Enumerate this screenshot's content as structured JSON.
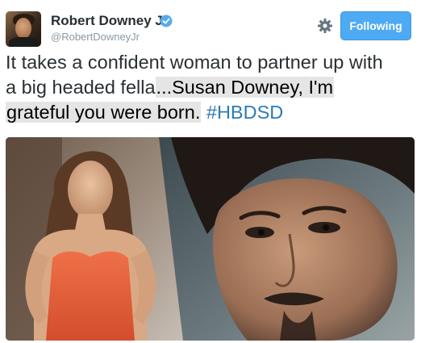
{
  "user": {
    "display_name": "Robert Downey Jr",
    "handle": "@RobertDowneyJr",
    "verified_icon": "verified-badge-icon",
    "avatar_icon": "profile-photo"
  },
  "actions": {
    "settings_icon": "gear-icon",
    "follow_label": "Following",
    "accent_color": "#4eaaf2"
  },
  "tweet": {
    "line1": "It takes a confident woman to partner up with",
    "line2_plain": "a big headed fella",
    "line2_highlight": "...Susan Downey, I'm",
    "line3_highlight": "grateful you were born.",
    "hashtag": "#HBDSD",
    "hashtag_color": "#2b7bb9"
  },
  "media": {
    "kind": "photo-collage"
  }
}
